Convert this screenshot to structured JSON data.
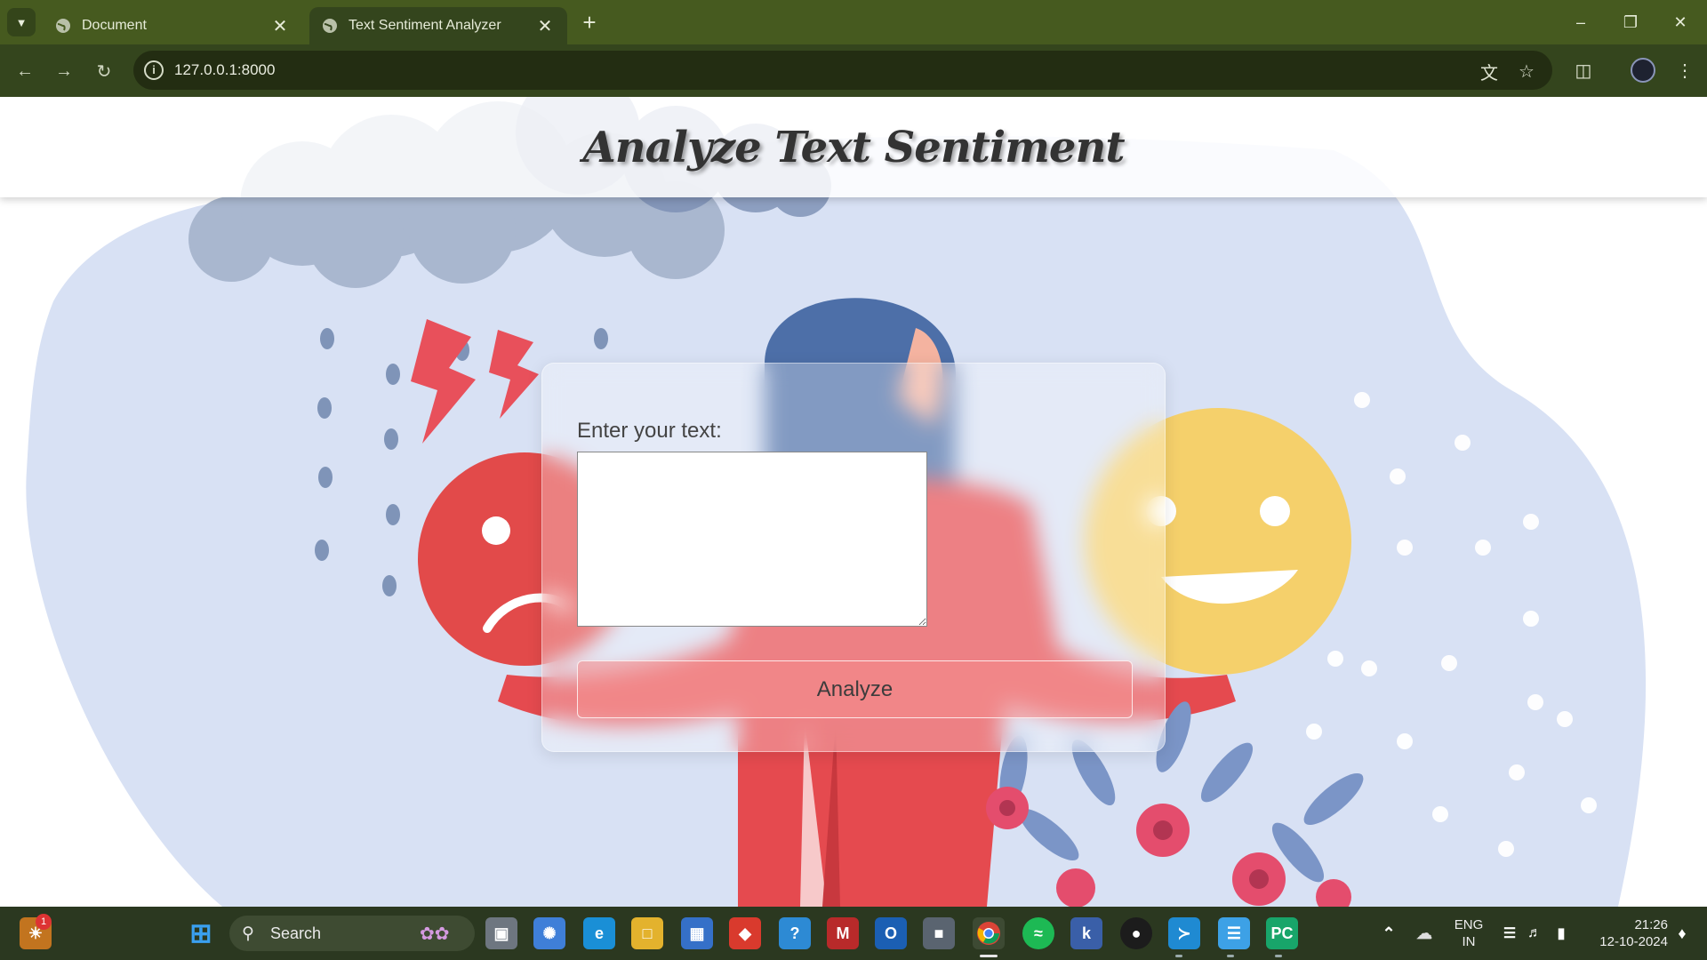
{
  "browser": {
    "tabs": [
      {
        "title": "Document",
        "active": false
      },
      {
        "title": "Text Sentiment Analyzer",
        "active": true
      }
    ],
    "url": "127.0.0.1:8000"
  },
  "page": {
    "title": "Analyze Text Sentiment",
    "input_label": "Enter your text:",
    "textarea_value": "",
    "button_label": "Analyze"
  },
  "taskbar": {
    "search_placeholder": "Search",
    "notification_count": "1",
    "language": "ENG",
    "region": "IN",
    "time": "21:26",
    "date": "12-10-2024"
  }
}
